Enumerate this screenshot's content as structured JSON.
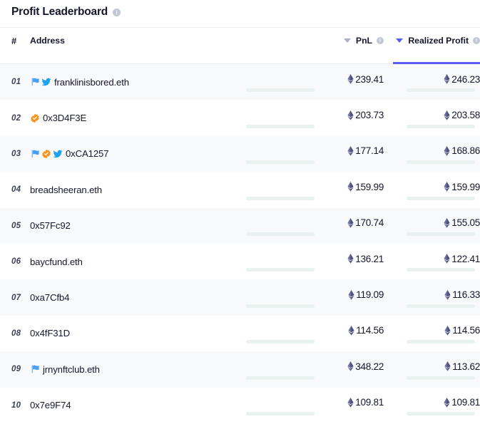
{
  "header": {
    "title": "Profit Leaderboard",
    "title_info_icon": "info-icon"
  },
  "table": {
    "columns": [
      {
        "key": "rank",
        "label": "#",
        "align": "left",
        "sortable": false,
        "active": false
      },
      {
        "key": "address",
        "label": "Address",
        "align": "left",
        "sortable": false,
        "active": false
      },
      {
        "key": "pnl",
        "label": "PnL",
        "align": "right",
        "sortable": true,
        "active": false,
        "has_info_icon": true,
        "sort_direction": "desc"
      },
      {
        "key": "realized",
        "label": "Realized Profit",
        "align": "right",
        "sortable": true,
        "active": true,
        "has_info_icon": true,
        "sort_direction": "desc"
      }
    ],
    "currency_icon": "ethereum-icon",
    "max_bar_value": 348.22,
    "rows": [
      {
        "rank": "01",
        "address": "franklinisbored.eth",
        "badges": [
          "flag-icon",
          "twitter-icon"
        ],
        "pnl": "239.41",
        "pnl_value": 239.41,
        "realized": "246.23",
        "realized_value": 246.23
      },
      {
        "rank": "02",
        "address": "0x3D4F3E",
        "badges": [
          "verified-icon"
        ],
        "pnl": "203.73",
        "pnl_value": 203.73,
        "realized": "203.58",
        "realized_value": 203.58
      },
      {
        "rank": "03",
        "address": "0xCA1257",
        "badges": [
          "flag-icon",
          "verified-icon",
          "twitter-icon"
        ],
        "pnl": "177.14",
        "pnl_value": 177.14,
        "realized": "168.86",
        "realized_value": 168.86
      },
      {
        "rank": "04",
        "address": "breadsheeran.eth",
        "badges": [],
        "pnl": "159.99",
        "pnl_value": 159.99,
        "realized": "159.99",
        "realized_value": 159.99
      },
      {
        "rank": "05",
        "address": "0x57Fc92",
        "badges": [],
        "pnl": "170.74",
        "pnl_value": 170.74,
        "realized": "155.05",
        "realized_value": 155.05
      },
      {
        "rank": "06",
        "address": "baycfund.eth",
        "badges": [],
        "pnl": "136.21",
        "pnl_value": 136.21,
        "realized": "122.41",
        "realized_value": 122.41
      },
      {
        "rank": "07",
        "address": "0xa7Cfb4",
        "badges": [],
        "pnl": "119.09",
        "pnl_value": 119.09,
        "realized": "116.33",
        "realized_value": 116.33
      },
      {
        "rank": "08",
        "address": "0x4fF31D",
        "badges": [],
        "pnl": "114.56",
        "pnl_value": 114.56,
        "realized": "114.56",
        "realized_value": 114.56
      },
      {
        "rank": "09",
        "address": "jrnynftclub.eth",
        "badges": [
          "flag-icon"
        ],
        "pnl": "348.22",
        "pnl_value": 348.22,
        "realized": "113.62",
        "realized_value": 113.62
      },
      {
        "rank": "10",
        "address": "0x7e9F74",
        "badges": [],
        "pnl": "109.81",
        "pnl_value": 109.81,
        "realized": "109.81",
        "realized_value": 109.81
      }
    ]
  },
  "colors": {
    "accent": "#5b5bf2",
    "bar_fill": "#8ed1ad",
    "bar_track": "#e9f2ee",
    "text": "#16172b",
    "row_alt": "#f8f9fb",
    "verified": "#f7931e",
    "twitter": "#1da1f2",
    "flag": "#4a9ff5"
  }
}
